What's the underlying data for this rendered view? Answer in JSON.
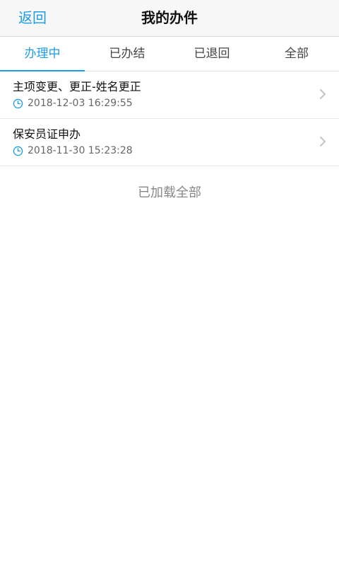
{
  "nav": {
    "back_label": "返回",
    "title": "我的办件"
  },
  "tabs": [
    {
      "label": "办理中",
      "active": true
    },
    {
      "label": "已办结",
      "active": false
    },
    {
      "label": "已退回",
      "active": false
    },
    {
      "label": "全部",
      "active": false
    }
  ],
  "items": [
    {
      "title": "主项变更、更正-姓名更正",
      "time": "2018-12-03 16:29:55",
      "icon": "clock-icon"
    },
    {
      "title": "保安员证申办",
      "time": "2018-11-30 15:23:28",
      "icon": "clock-icon"
    }
  ],
  "footer": {
    "load_status": "已加载全部"
  },
  "colors": {
    "accent": "#1c9be6",
    "navbar_bg": "#f7f7f7",
    "text_secondary": "#666666"
  }
}
